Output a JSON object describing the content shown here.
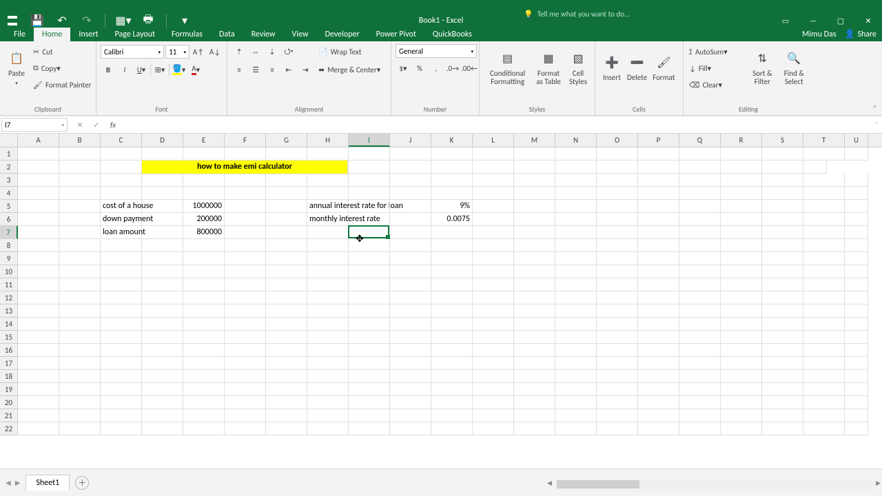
{
  "title": "Book1 - Excel",
  "user": "Mimu Das",
  "share_label": "Share",
  "tell_me": "Tell me what you want to do...",
  "tabs": [
    "File",
    "Home",
    "Insert",
    "Page Layout",
    "Formulas",
    "Data",
    "Review",
    "View",
    "Developer",
    "Power Pivot",
    "QuickBooks"
  ],
  "active_tab": 1,
  "ribbon": {
    "clipboard": {
      "label": "Clipboard",
      "paste": "Paste",
      "cut": "Cut",
      "copy": "Copy",
      "painter": "Format Painter"
    },
    "font": {
      "label": "Font",
      "family": "Calibri",
      "size": "11"
    },
    "alignment": {
      "label": "Alignment",
      "wrap": "Wrap Text",
      "merge": "Merge & Center"
    },
    "number": {
      "label": "Number",
      "format": "General"
    },
    "styles": {
      "label": "Styles",
      "cond": "Conditional Formatting",
      "table": "Format as Table",
      "cell": "Cell Styles"
    },
    "cells": {
      "label": "Cells",
      "insert": "Insert",
      "delete": "Delete",
      "format": "Format"
    },
    "editing": {
      "label": "Editing",
      "autosum": "AutoSum",
      "fill": "Fill",
      "clear": "Clear",
      "sort": "Sort & Filter",
      "find": "Find & Select"
    }
  },
  "name_box": "I7",
  "formula": "",
  "columns": [
    "A",
    "B",
    "C",
    "D",
    "E",
    "F",
    "G",
    "H",
    "I",
    "J",
    "K",
    "L",
    "M",
    "N",
    "O",
    "P",
    "Q",
    "R",
    "S",
    "T",
    "U"
  ],
  "selected_col": "I",
  "selected_row": 7,
  "sheet_tab": "Sheet1",
  "cells": {
    "D2_span": "how to make emi calculator",
    "C5": "cost of a house",
    "E5": "1000000",
    "C6": "down payment",
    "E6": "200000",
    "C7": "loan amount",
    "E7": "800000",
    "H5": "annual interest rate for loan",
    "K5": "9%",
    "H6": "monthly interest rate",
    "K6": "0.0075"
  }
}
